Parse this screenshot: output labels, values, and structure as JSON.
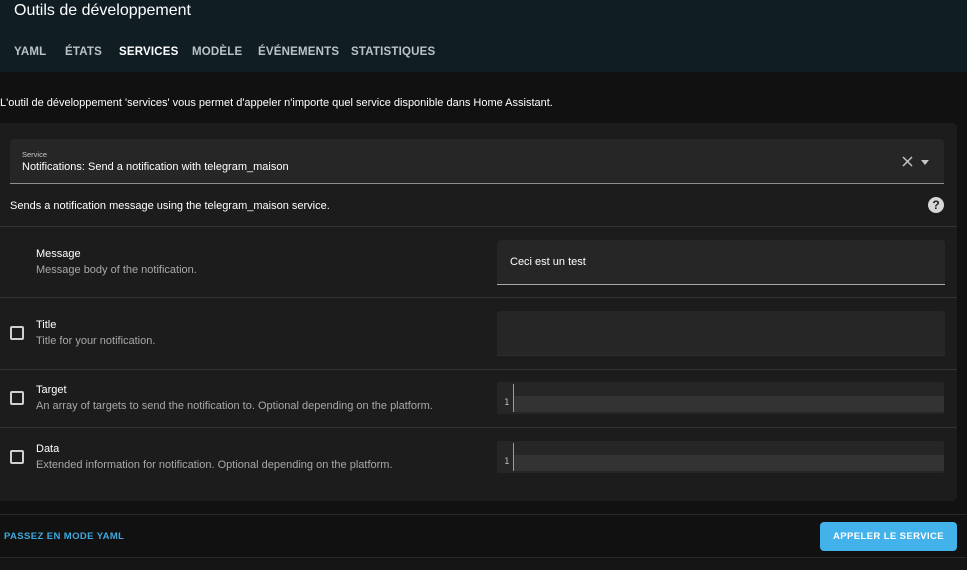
{
  "header": {
    "title": "Outils de développement",
    "tabs": [
      {
        "label": "YAML",
        "active": false
      },
      {
        "label": "ÉTATS",
        "active": false
      },
      {
        "label": "SERVICES",
        "active": true
      },
      {
        "label": "MODÈLE",
        "active": false
      },
      {
        "label": "ÉVÉNEMENTS",
        "active": false
      },
      {
        "label": "STATISTIQUES",
        "active": false
      }
    ]
  },
  "intro_text": "L'outil de développement 'services' vous permet d'appeler n'importe quel service disponible dans Home Assistant.",
  "service": {
    "label": "Service",
    "value": "Notifications: Send a notification with telegram_maison",
    "description": "Sends a notification message using the telegram_maison service.",
    "clear_icon": "close-icon",
    "dropdown_icon": "chevron-down-icon",
    "help_icon": "help-circle-icon"
  },
  "fields": [
    {
      "name": "Message",
      "description": "Message body of the notification.",
      "value": "Ceci est un test",
      "type": "text",
      "optional": false
    },
    {
      "name": "Title",
      "description": "Title for your notification.",
      "value": "",
      "type": "text",
      "optional": true
    },
    {
      "name": "Target",
      "description": "An array of targets to send the notification to. Optional depending on the platform.",
      "line_number": "1",
      "type": "code",
      "optional": true
    },
    {
      "name": "Data",
      "description": "Extended information for notification. Optional depending on the platform.",
      "line_number": "1",
      "type": "code",
      "optional": true
    }
  ],
  "footer": {
    "yaml_mode_label": "PASSEZ EN MODE YAML",
    "call_service_label": "APPELER LE SERVICE"
  },
  "colors": {
    "header_bg": "#101e24",
    "accent": "#44b2ea",
    "link": "#3fa9de",
    "card_bg": "#1c1c1c"
  }
}
